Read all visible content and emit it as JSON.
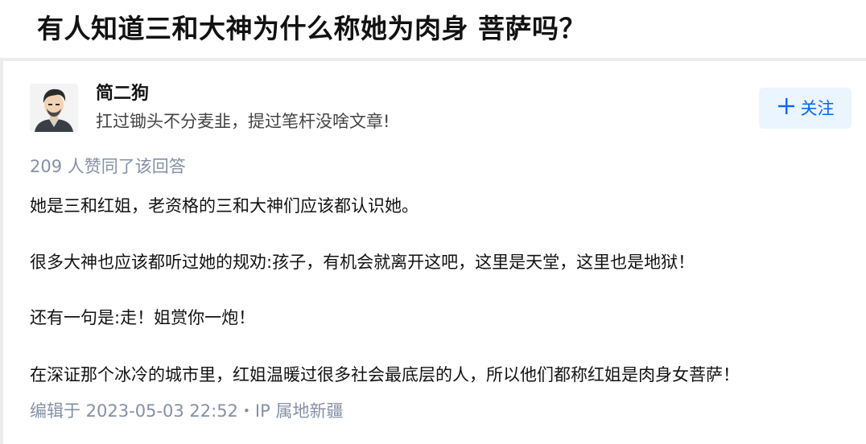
{
  "question": {
    "title": "有人知道三和大神为什么称她为肉身 菩萨吗？"
  },
  "author": {
    "name": "简二狗",
    "headline": "扛过锄头不分麦韭，提过笔杆没啥文章!",
    "avatar_icon": "avatar-icon"
  },
  "follow_button": {
    "icon": "plus-icon",
    "label": "关注",
    "color": "#0066ff",
    "background": "#ebf5ff"
  },
  "answer": {
    "vote_text": "209 人赞同了该回答",
    "paragraphs": [
      "她是三和红姐，老资格的三和大神们应该都认识她。",
      "很多大神也应该都听过她的规劝:孩子，有机会就离开这吧，这里是天堂，这里也是地狱！",
      "还有一句是:走！姐赏你一炮！",
      "在深证那个冰冷的城市里，红姐温暖过很多社会最底层的人，所以他们都称红姐是肉身女菩萨！"
    ],
    "edit_info": "编辑于 2023-05-03 22:52・IP 属地新疆"
  }
}
